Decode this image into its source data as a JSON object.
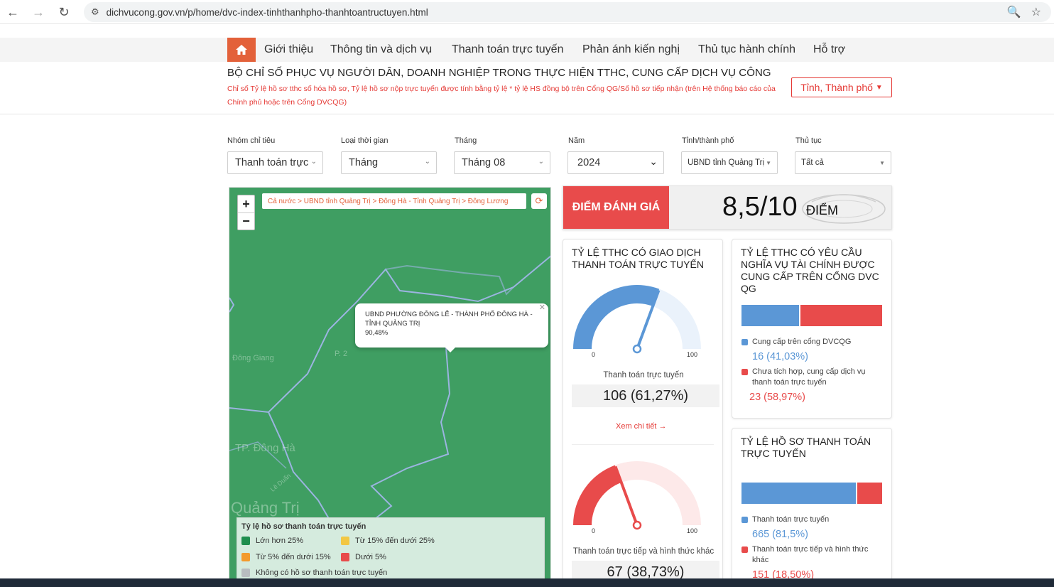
{
  "browser": {
    "url": "dichvucong.gov.vn/p/home/dvc-index-tinhthanhpho-thanhtoantructuyen.html"
  },
  "nav": {
    "items": [
      "Giới thiệu",
      "Thông tin và dịch vụ",
      "Thanh toán trực tuyến",
      "Phản ánh kiến nghị",
      "Thủ tục hành chính",
      "Hỗ trợ"
    ]
  },
  "header": {
    "title": "BỘ CHỈ SỐ PHỤC VỤ NGƯỜI DÂN, DOANH NGHIỆP TRONG THỰC HIỆN TTHC, CUNG CẤP DỊCH VỤ CÔNG",
    "note": "Chỉ số Tỷ lệ hồ sơ tthc số hóa hồ sơ, Tỷ lệ hồ sơ nộp trực tuyến được tính bằng tỷ lệ * tỷ lệ HS đồng bộ trên Cổng QG/Số hồ sơ tiếp nhận (trên Hệ thống báo cáo của Chính phủ hoặc trên Cổng DVCQG)",
    "province_button": "Tỉnh, Thành phố"
  },
  "filters": [
    {
      "label": "Nhóm chỉ tiêu",
      "value": "Thanh toán trực"
    },
    {
      "label": "Loại thời gian",
      "value": "Tháng"
    },
    {
      "label": "Tháng",
      "value": "Tháng 08"
    },
    {
      "label": "Năm",
      "value": "2024"
    },
    {
      "label": "Tỉnh/thành phố",
      "value": "UBND tỉnh Quảng Trị"
    },
    {
      "label": "Thủ tục",
      "value": "Tất cả"
    }
  ],
  "map": {
    "breadcrumb": "Cả nước > UBND tỉnh Quảng Trị > Đông Hà - Tỉnh Quảng Trị > Đông Lương",
    "labels": [
      "Đông Giang",
      "P. 2",
      "TP. Đông Hà",
      "Lê Duẩn",
      "Quảng Trị"
    ],
    "popup": {
      "name": "UBND PHƯỜNG ĐÔNG LỄ - THÀNH PHỐ ĐÔNG HÀ - TỈNH QUẢNG TRỊ",
      "value": "90,48%"
    },
    "legend": {
      "title": "Tỷ lệ hồ sơ thanh toán trực tuyến",
      "items": [
        {
          "label": "Lớn hơn 25%",
          "color": "#1e8e4e"
        },
        {
          "label": "Từ 15% đến dưới 25%",
          "color": "#f2c744"
        },
        {
          "label": "Từ 5% đến dưới 15%",
          "color": "#f39a2c"
        },
        {
          "label": "Dưới 5%",
          "color": "#e84b4b"
        },
        {
          "label": "Không có hồ sơ thanh toán trực tuyến",
          "color": "#b8bdc0"
        }
      ]
    }
  },
  "score": {
    "label": "ĐIỂM ĐÁNH GIÁ",
    "value": "8,5/10",
    "unit": "ĐIỂM"
  },
  "card_gauge": {
    "title": "TỶ LỆ TTHC CÓ GIAO DỊCH THANH TOÁN TRỰC TUYẾN",
    "gauge1": {
      "min": "0",
      "max": "100",
      "percent": 61.27,
      "label": "Thanh toán trực tuyến",
      "value": "106 (61,27%)",
      "color": "#5b97d6"
    },
    "link": "Xem chi tiết →",
    "gauge2": {
      "min": "0",
      "max": "100",
      "percent": 38.73,
      "label": "Thanh toán trực tiếp và hình thức khác",
      "value": "67 (38,73%)",
      "color": "#e84b4b"
    }
  },
  "card_finance": {
    "title": "TỶ LỆ TTHC CÓ YÊU CẦU NGHĨA VỤ TÀI CHÍNH ĐƯỢC CUNG CẤP TRÊN CỔNG DVC QG",
    "blue_share": 41.03,
    "legend1": "Cung cấp trên cổng DVCQG",
    "value1": "16 (41,03%)",
    "legend2": "Chưa tích hợp, cung cấp dịch vụ thanh toán trực tuyến",
    "value2": "23 (58,97%)",
    "color1": "#5b97d6",
    "color2": "#e84b4b"
  },
  "card_records": {
    "title": "TỶ LỆ HỒ SƠ THANH TOÁN TRỰC TUYẾN",
    "blue_share": 81.5,
    "legend1": "Thanh toán trực tuyến",
    "value1": "665 (81,5%)",
    "legend2": "Thanh toán trực tiếp và hình thức khác",
    "value2": "151 (18,50%)"
  }
}
